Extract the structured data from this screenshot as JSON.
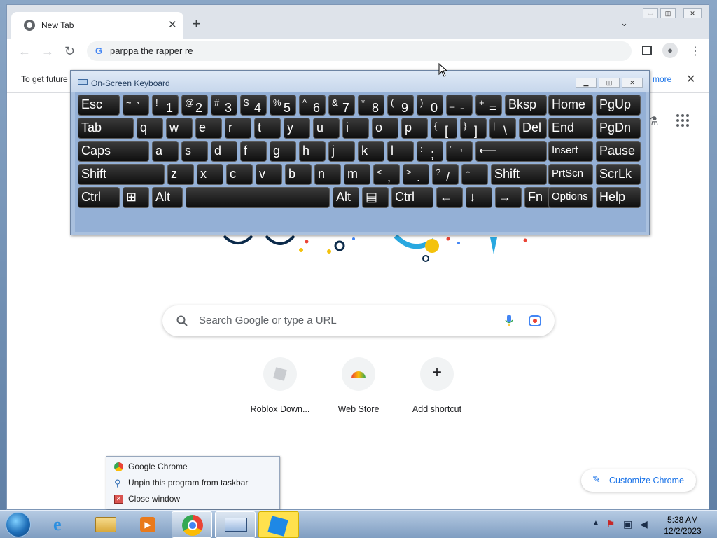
{
  "browser": {
    "tab_title": "New Tab",
    "omnibox_text": "parppa the rapper re",
    "infobar_text": "To get future",
    "infobar_link": "more",
    "search_placeholder": "Search Google or type a URL",
    "customize_label": "Customize Chrome",
    "shortcuts": [
      {
        "label": "Roblox Down..."
      },
      {
        "label": "Web Store"
      },
      {
        "label": "Add shortcut",
        "icon": "+"
      }
    ]
  },
  "osk": {
    "title": "On-Screen Keyboard",
    "rows": [
      [
        {
          "label": "Esc"
        },
        {
          "top": "~",
          "bottom": "`"
        },
        {
          "top": "!",
          "bottom": "1"
        },
        {
          "top": "@",
          "bottom": "2"
        },
        {
          "top": "#",
          "bottom": "3"
        },
        {
          "top": "$",
          "bottom": "4"
        },
        {
          "top": "%",
          "bottom": "5"
        },
        {
          "top": "^",
          "bottom": "6"
        },
        {
          "top": "&",
          "bottom": "7"
        },
        {
          "top": "*",
          "bottom": "8"
        },
        {
          "top": "(",
          "bottom": "9"
        },
        {
          "top": ")",
          "bottom": "0"
        },
        {
          "top": "_",
          "bottom": "-"
        },
        {
          "top": "+",
          "bottom": "="
        },
        {
          "label": "Bksp"
        },
        {
          "label": "Home"
        },
        {
          "label": "PgUp"
        }
      ],
      [
        {
          "label": "Tab"
        },
        {
          "label": "q"
        },
        {
          "label": "w"
        },
        {
          "label": "e"
        },
        {
          "label": "r"
        },
        {
          "label": "t"
        },
        {
          "label": "y"
        },
        {
          "label": "u"
        },
        {
          "label": "i"
        },
        {
          "label": "o"
        },
        {
          "label": "p"
        },
        {
          "top": "{",
          "bottom": "["
        },
        {
          "top": "}",
          "bottom": "]"
        },
        {
          "top": "|",
          "bottom": "\\"
        },
        {
          "label": "Del"
        },
        {
          "label": "End"
        },
        {
          "label": "PgDn"
        }
      ],
      [
        {
          "label": "Caps"
        },
        {
          "label": "a"
        },
        {
          "label": "s"
        },
        {
          "label": "d"
        },
        {
          "label": "f"
        },
        {
          "label": "g"
        },
        {
          "label": "h"
        },
        {
          "label": "j"
        },
        {
          "label": "k"
        },
        {
          "label": "l"
        },
        {
          "top": ":",
          "bottom": ";"
        },
        {
          "top": "\"",
          "bottom": "'"
        },
        {
          "label": "⟵"
        },
        {
          "label": "Insert"
        },
        {
          "label": "Pause"
        }
      ],
      [
        {
          "label": "Shift"
        },
        {
          "label": "z"
        },
        {
          "label": "x"
        },
        {
          "label": "c"
        },
        {
          "label": "v"
        },
        {
          "label": "b"
        },
        {
          "label": "n"
        },
        {
          "label": "m"
        },
        {
          "top": "<",
          "bottom": ","
        },
        {
          "top": ">",
          "bottom": "."
        },
        {
          "top": "?",
          "bottom": "/"
        },
        {
          "label": "↑"
        },
        {
          "label": "Shift"
        },
        {
          "label": "PrtScn"
        },
        {
          "label": "ScrLk"
        }
      ],
      [
        {
          "label": "Ctrl"
        },
        {
          "label": "⊞"
        },
        {
          "label": "Alt"
        },
        {
          "label": ""
        },
        {
          "label": "Alt"
        },
        {
          "label": "▤"
        },
        {
          "label": "Ctrl"
        },
        {
          "label": "←"
        },
        {
          "label": "↓"
        },
        {
          "label": "→"
        },
        {
          "label": "Fn"
        },
        {
          "label": "Options"
        },
        {
          "label": "Help"
        }
      ]
    ]
  },
  "context_menu": {
    "items": [
      {
        "label": "Google Chrome",
        "icon": "chrome-icon"
      },
      {
        "label": "Unpin this program from taskbar",
        "icon": "unpin-icon"
      },
      {
        "label": "Close window",
        "icon": "close-window-icon"
      }
    ]
  },
  "taskbar": {
    "time": "5:38 AM",
    "date": "12/2/2023"
  }
}
